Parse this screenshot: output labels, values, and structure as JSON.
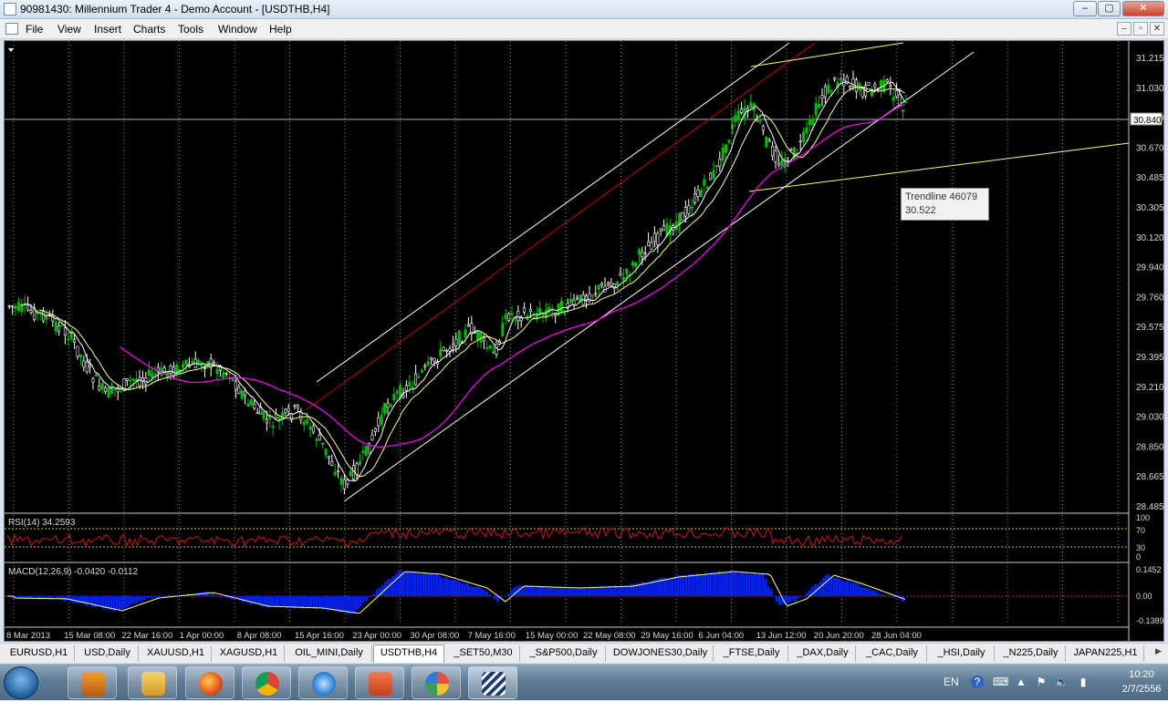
{
  "window": {
    "title": "90981430: Millennium Trader 4 - Demo Account - [USDTHB,H4]",
    "controls": [
      "–",
      "▢",
      "✕"
    ]
  },
  "menu": {
    "items": [
      "File",
      "View",
      "Insert",
      "Charts",
      "Tools",
      "Window",
      "Help"
    ],
    "mdi_controls": [
      "–",
      "▫",
      "✕"
    ]
  },
  "chart": {
    "symbol": "USDTHB",
    "timeframe": "H4",
    "current_price_label": "30.840",
    "price_ticks": [
      "31.215",
      "31.030",
      "30.840",
      "30.670",
      "30.485",
      "30.305",
      "30.120",
      "29.940",
      "29.760",
      "29.575",
      "29.395",
      "29.210",
      "29.030",
      "28.850",
      "28.665",
      "28.485"
    ],
    "time_ticks": [
      "8 Mar 2013",
      "15 Mar 08:00",
      "22 Mar 16:00",
      "1 Apr 00:00",
      "8 Apr 08:00",
      "15 Apr 16:00",
      "23 Apr 00:00",
      "30 Apr 08:00",
      "7 May 16:00",
      "15 May 00:00",
      "22 May 08:00",
      "29 May 16:00",
      "6 Jun 04:00",
      "13 Jun 12:00",
      "20 Jun 20:00",
      "28 Jun 04:00"
    ],
    "tooltip": {
      "line1": "Trendline 46079",
      "line2": "30.522"
    },
    "colors": {
      "bull_candle": "#00c000",
      "bear_candle": "#ffffff",
      "ma_fast": "#ffffff",
      "ma_mid": "#ffff80",
      "ma_slow": "#ff00ff",
      "channel_white": "#ffffff",
      "channel_red": "#cc0000",
      "trendline_yellow": "#ffff66"
    }
  },
  "rsi": {
    "label": "RSI(14) 34.2593",
    "levels": [
      "100",
      "70",
      "30",
      "0"
    ]
  },
  "macd": {
    "label": "MACD(12,26,9) -0.0420 -0.0112",
    "levels": [
      "0.1452",
      "0.00",
      "-0.1389"
    ]
  },
  "tabs": [
    "EURUSD,H1",
    "USD,Daily",
    "XAUUSD,H1",
    "XAGUSD,H1",
    "OIL_MINI,Daily",
    "USDTHB,H4",
    "_SET50,M30",
    "_S&P500,Daily",
    "DOWJONES30,Daily",
    "_FTSE,Daily",
    "_DAX,Daily",
    "_CAC,Daily",
    "_HSI,Daily",
    "_N225,Daily",
    "JAPAN225,H1"
  ],
  "active_tab": "USDTHB,H4",
  "taskbar": {
    "apps": [
      "media-player-icon",
      "file-explorer-icon",
      "firefox-icon",
      "chrome-icon",
      "internet-explorer-icon",
      "powerpoint-icon",
      "paint-icon",
      "trader-icon"
    ],
    "language": "EN",
    "clock_time": "10:20",
    "clock_date": "2/7/2556"
  }
}
